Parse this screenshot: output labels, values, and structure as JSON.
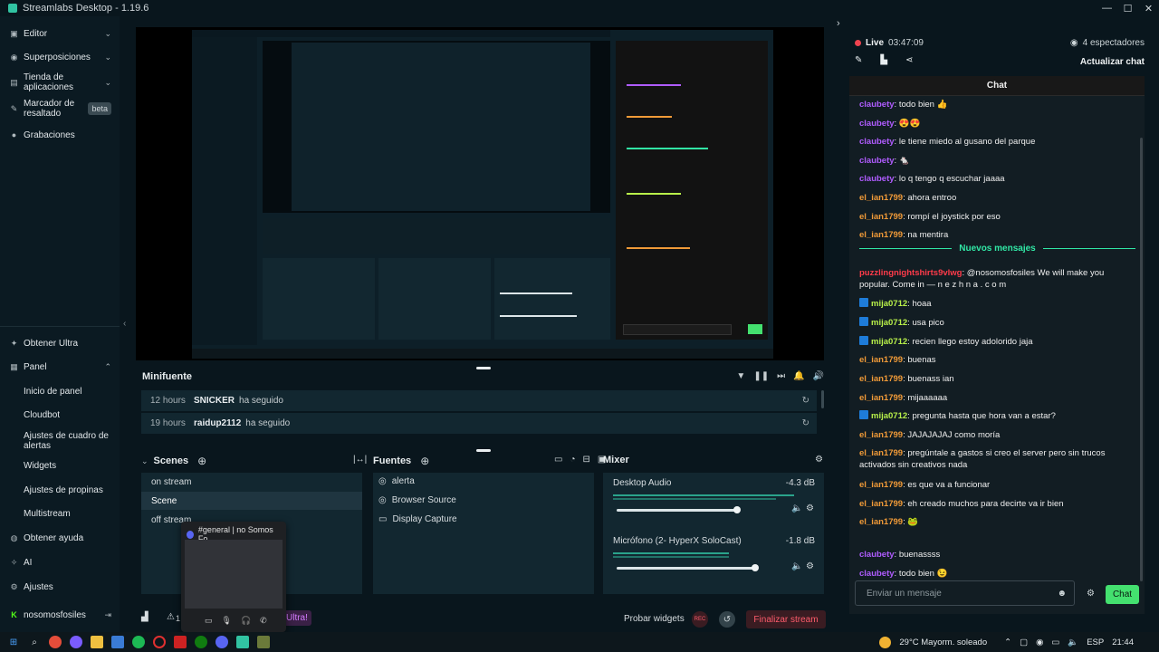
{
  "titlebar": {
    "title": "Streamlabs Desktop - 1.19.6",
    "min": "—",
    "max": "☐",
    "close": "✕"
  },
  "sidebar": {
    "top_items": [
      {
        "label": "Editor",
        "icon": "editor-icon",
        "glyph": "▣",
        "chevron": "⌄"
      },
      {
        "label": "Superposiciones",
        "icon": "overlays-icon",
        "glyph": "◉",
        "chevron": "⌄"
      },
      {
        "label": "Tienda de aplicaciones",
        "icon": "app-store-icon",
        "glyph": "▤",
        "chevron": "⌄"
      },
      {
        "label": "Marcador de resaltado",
        "icon": "highlighter-icon",
        "glyph": "✎",
        "badge": "beta"
      },
      {
        "label": "Grabaciones",
        "icon": "recordings-icon",
        "glyph": "●"
      }
    ],
    "bottom_items": [
      {
        "label": "Obtener Ultra",
        "icon": "ultra-icon",
        "glyph": "✦"
      },
      {
        "label": "Panel",
        "icon": "dashboard-icon",
        "glyph": "▦",
        "chevron": "⌃"
      },
      {
        "label": "Inicio de panel",
        "sub": true
      },
      {
        "label": "Cloudbot",
        "sub": true
      },
      {
        "label": "Ajustes de cuadro de alertas",
        "sub": true
      },
      {
        "label": "Widgets",
        "sub": true
      },
      {
        "label": "Ajustes de propinas",
        "sub": true
      },
      {
        "label": "Multistream",
        "sub": true
      },
      {
        "label": "Obtener ayuda",
        "icon": "help-icon",
        "glyph": "◍"
      },
      {
        "label": "AI",
        "icon": "ai-icon",
        "glyph": "✧"
      },
      {
        "label": "Ajustes",
        "icon": "settings-icon",
        "glyph": "⚙"
      },
      {
        "label": "nosomosfosiles",
        "icon": "kick-icon",
        "glyph": "K",
        "logout": "⇥"
      }
    ],
    "collapse": "‹"
  },
  "minifuente": {
    "title": "Minifuente",
    "rows": [
      {
        "time": "12 hours",
        "name": "SNICKER",
        "action": "ha seguido"
      },
      {
        "time": "19 hours",
        "name": "raidup2112",
        "action": "ha seguido"
      }
    ]
  },
  "scenes": {
    "title": "Scenes",
    "items": [
      "on stream",
      "Scene",
      "off stream"
    ],
    "selected": 1
  },
  "sources": {
    "title": "Fuentes",
    "items": [
      "alerta",
      "Browser Source",
      "Display Capture"
    ]
  },
  "mixer": {
    "title": "Mixer",
    "channels": [
      {
        "name": "Desktop Audio",
        "db": "-4.3 dB",
        "level": 0.85
      },
      {
        "name": "Micrófono (2- HyperX SoloCast)",
        "db": "-1.8 dB",
        "level": 0.92
      }
    ]
  },
  "footer": {
    "test_widgets": "Probar widgets",
    "rec": "REC",
    "end_stream": "Finalizar stream",
    "ultra_label": "Ultra!",
    "warn_count": "1"
  },
  "discord_popup": {
    "title": "#general | no Somos Fo..."
  },
  "live": {
    "label": "Live",
    "time": "03:47:09",
    "viewers": "4 espectadores",
    "update_chat": "Actualizar chat"
  },
  "chat": {
    "title": "Chat",
    "new_messages": "Nuevos mensajes",
    "placeholder": "Enviar un mensaje",
    "send": "Chat",
    "messages": [
      {
        "user": "claubety",
        "color": "#b05cff",
        "text": "todo bien 👍"
      },
      {
        "user": "claubety",
        "color": "#b05cff",
        "text": "😍😍"
      },
      {
        "user": "claubety",
        "color": "#b05cff",
        "text": "le tiene miedo al gusano del parque"
      },
      {
        "user": "claubety",
        "color": "#b05cff",
        "text": "🐁"
      },
      {
        "user": "claubety",
        "color": "#b05cff",
        "text": "lo q tengo q escuchar jaaaa"
      },
      {
        "user": "el_ian1799",
        "color": "#f09a38",
        "text": "ahora entroo"
      },
      {
        "user": "el_ian1799",
        "color": "#f09a38",
        "text": "rompí el joystick por eso"
      },
      {
        "user": "el_ian1799",
        "color": "#f09a38",
        "text": "na mentira"
      },
      {
        "user": "puzzlingnightshirts9vlwg",
        "color": "#ff3b4a",
        "text": "@nosomosfosiles We will make you popular. Come in — n e z h n a . c o m"
      },
      {
        "user": "mija0712",
        "color": "#b8f04a",
        "text": "hoaa",
        "badge": true
      },
      {
        "user": "mija0712",
        "color": "#b8f04a",
        "text": "usa pico",
        "badge": true
      },
      {
        "user": "mija0712",
        "color": "#b8f04a",
        "text": "recien llego estoy adolorido jaja",
        "badge": true
      },
      {
        "user": "el_ian1799",
        "color": "#f09a38",
        "text": "buenas"
      },
      {
        "user": "el_ian1799",
        "color": "#f09a38",
        "text": "buenass ian"
      },
      {
        "user": "el_ian1799",
        "color": "#f09a38",
        "text": "mijaaaaaa"
      },
      {
        "user": "mija0712",
        "color": "#b8f04a",
        "text": "pregunta hasta que hora van a estar?",
        "badge": true
      },
      {
        "user": "el_ian1799",
        "color": "#f09a38",
        "text": "JAJAJAJAJ como moría"
      },
      {
        "user": "el_ian1799",
        "color": "#f09a38",
        "text": "pregúntale a gastos si creo el server pero sin trucos activados sin creativos nada"
      },
      {
        "user": "el_ian1799",
        "color": "#f09a38",
        "text": "es que va a funcionar"
      },
      {
        "user": "el_ian1799",
        "color": "#f09a38",
        "text": "eh creado muchos para decirte va ir bien"
      },
      {
        "user": "el_ian1799",
        "color": "#f09a38",
        "text": "🐸"
      },
      {
        "user": "claubety",
        "color": "#b05cff",
        "text": "buenassss"
      },
      {
        "user": "claubety",
        "color": "#b05cff",
        "text": "todo bien 😉"
      }
    ]
  },
  "taskbar": {
    "weather": "29°C  Mayorm. soleado",
    "lang": "ESP",
    "time": "21:44"
  },
  "colors": {
    "accent": "#31c3a2",
    "live_red": "#f0434f",
    "send_green": "#44e06f",
    "end_stream_red": "#ff5c6c"
  }
}
